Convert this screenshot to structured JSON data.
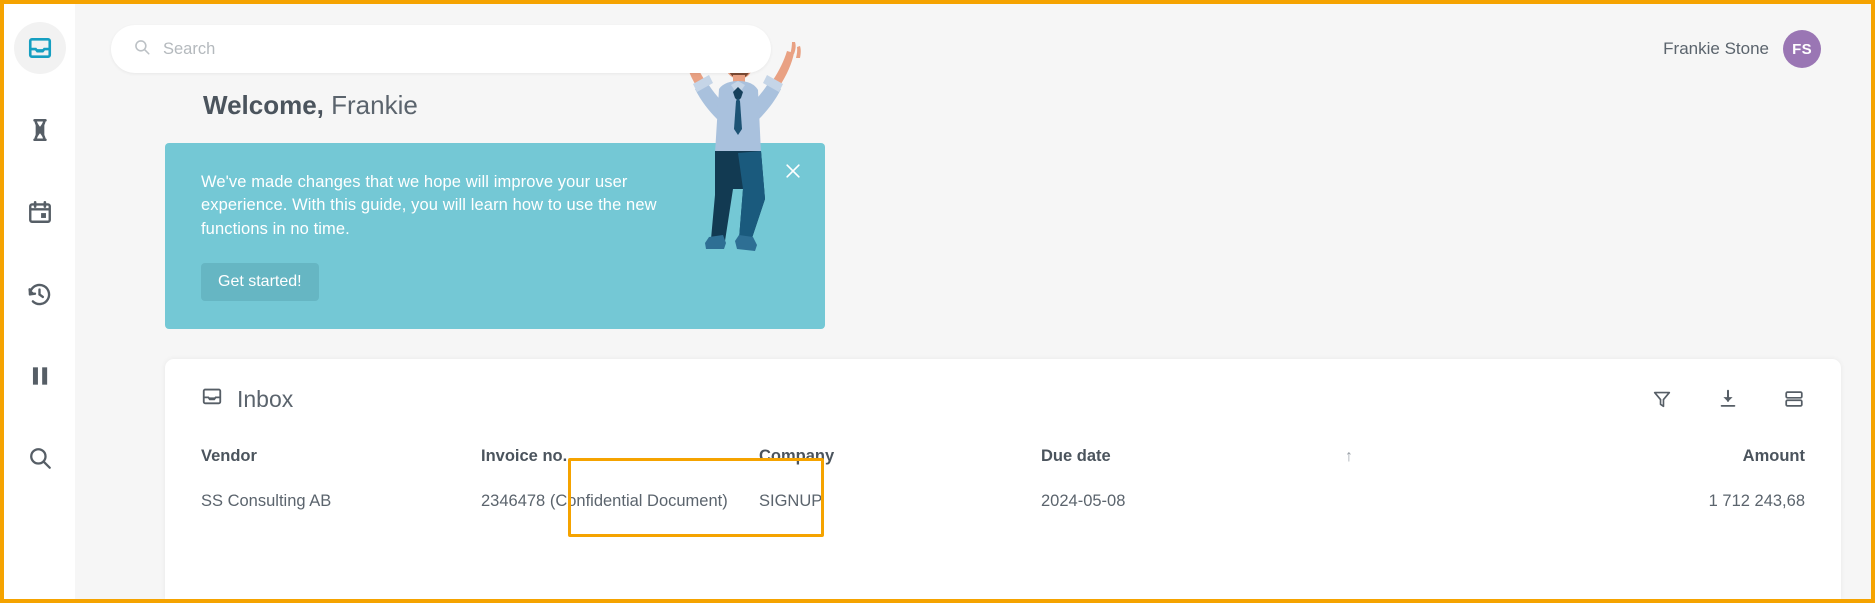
{
  "sidebar": {
    "items": [
      {
        "name": "inbox",
        "icon": "inbox-icon",
        "active": true
      },
      {
        "name": "hourglass",
        "icon": "hourglass-icon",
        "active": false
      },
      {
        "name": "calendar",
        "icon": "calendar-icon",
        "active": false
      },
      {
        "name": "history",
        "icon": "history-icon",
        "active": false
      },
      {
        "name": "pause",
        "icon": "pause-icon",
        "active": false
      },
      {
        "name": "search",
        "icon": "search-icon",
        "active": false
      }
    ]
  },
  "topbar": {
    "search_placeholder": "Search",
    "search_value": "",
    "user_name": "Frankie Stone",
    "avatar_initials": "FS"
  },
  "welcome": {
    "greeting": "Welcome,",
    "first_name": "Frankie"
  },
  "banner": {
    "text": "We've made changes that we hope will improve your user experience. With this guide, you will learn how to use the new functions in no time.",
    "button_label": "Get started!",
    "close_label": "×",
    "background_color": "#74c8d5",
    "button_color": "#66b6c3"
  },
  "inbox": {
    "title": "Inbox",
    "actions": [
      {
        "name": "filter",
        "icon": "filter-icon"
      },
      {
        "name": "download",
        "icon": "download-icon"
      },
      {
        "name": "layout",
        "icon": "layout-toggle-icon"
      }
    ],
    "columns": [
      {
        "key": "vendor",
        "label": "Vendor",
        "sorted": false,
        "align": "left"
      },
      {
        "key": "invoice",
        "label": "Invoice no.",
        "sorted": false,
        "align": "left"
      },
      {
        "key": "company",
        "label": "Company",
        "sorted": false,
        "align": "left"
      },
      {
        "key": "due",
        "label": "Due date",
        "sorted": true,
        "align": "left"
      },
      {
        "key": "amount",
        "label": "Amount",
        "sorted": false,
        "align": "right"
      }
    ],
    "sort_arrow": "↑",
    "rows": [
      {
        "vendor": "SS Consulting AB",
        "invoice": "2346478 (Confidential Document)",
        "company": "SIGNUP",
        "due": "2024-05-08",
        "amount": "1 712 243,68"
      }
    ]
  },
  "highlight": {
    "color": "#f5a300",
    "target": "invoice-column"
  }
}
